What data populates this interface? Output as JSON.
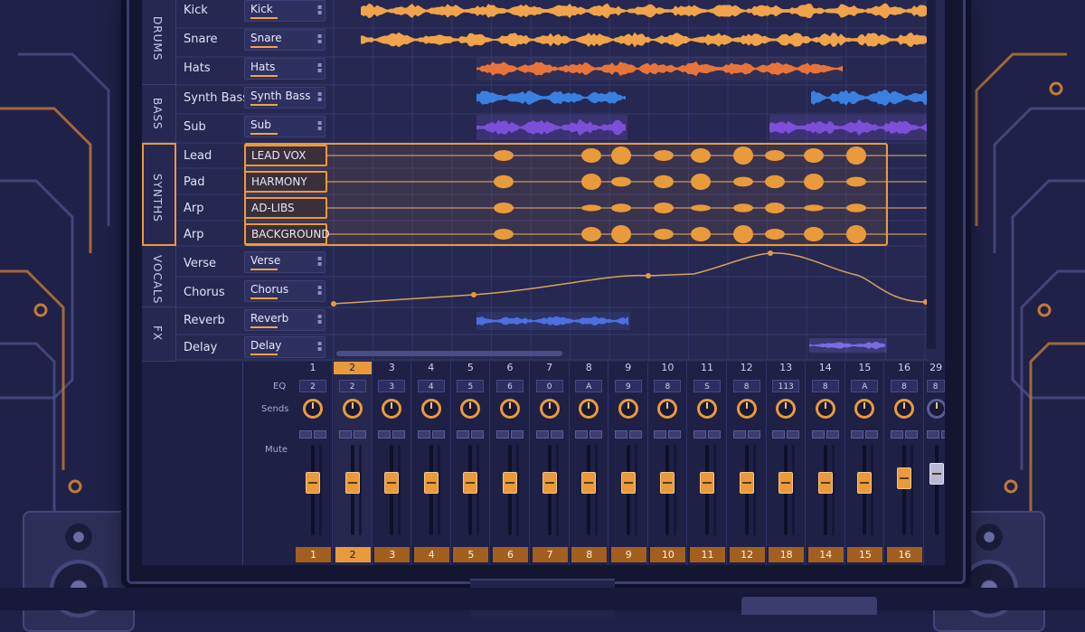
{
  "daw": {
    "groups": [
      {
        "label": "DRUMS",
        "tracks": [
          {
            "name": "Kick",
            "box": "Kick"
          },
          {
            "name": "Snare",
            "box": "Snare"
          },
          {
            "name": "Hats",
            "box": "Hats"
          }
        ]
      },
      {
        "label": "BASS",
        "tracks": [
          {
            "name": "Synth Bass",
            "box": "Synth Bass"
          },
          {
            "name": "Sub",
            "box": "Sub"
          }
        ]
      },
      {
        "label": "SYNTHS",
        "tracks": [
          {
            "name": "Lead",
            "box": "LEAD VOX"
          },
          {
            "name": "Pad",
            "box": "HARMONY"
          },
          {
            "name": "Arp",
            "box": "AD-LIBS"
          },
          {
            "name": "Arp",
            "box": "BACKGROUND"
          }
        ]
      },
      {
        "label": "VOCALS",
        "tracks": [
          {
            "name": "Verse",
            "box": "Verse"
          },
          {
            "name": "Chorus",
            "box": "Chorus"
          }
        ]
      },
      {
        "label": "FX",
        "tracks": [
          {
            "name": "Reverb",
            "box": "Reverb"
          },
          {
            "name": "Delay",
            "box": "Delay"
          }
        ]
      }
    ],
    "mixer": {
      "labels": {
        "eq": "EQ",
        "sends": "Sends",
        "mute": "Mute"
      },
      "channel_numbers": [
        "1",
        "2",
        "3",
        "4",
        "5",
        "6",
        "7",
        "8",
        "9",
        "10",
        "11",
        "12",
        "13",
        "14",
        "15",
        "16",
        "29"
      ],
      "eq_labels": [
        "2",
        "2",
        "3",
        "4",
        "5",
        "6",
        "0",
        "A",
        "9",
        "8",
        "S",
        "8",
        "113",
        "8",
        "A",
        "8",
        "8"
      ],
      "footer_numbers": [
        "1",
        "2",
        "3",
        "4",
        "5",
        "6",
        "7",
        "8",
        "9",
        "10",
        "11",
        "12",
        "18",
        "14",
        "15",
        "16"
      ],
      "fader_levels": [
        0.3,
        0.3,
        0.3,
        0.3,
        0.3,
        0.3,
        0.3,
        0.3,
        0.3,
        0.3,
        0.3,
        0.3,
        0.3,
        0.3,
        0.3,
        0.25,
        0.2
      ],
      "selected_channel": "2"
    }
  },
  "colors": {
    "accent": "#e99a3c",
    "drums": "#f0a34a",
    "hats": "#e9743a",
    "bass": "#3b7fe0",
    "sub": "#7b4fd8",
    "vocal": "#e99a3c",
    "fx": "#4e6fe0"
  }
}
